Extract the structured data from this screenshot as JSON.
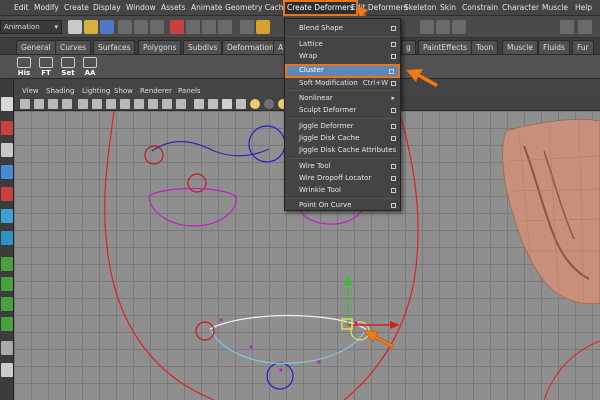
{
  "menubar": {
    "items": [
      "Edit",
      "Modify",
      "Create",
      "Display",
      "Window",
      "Assets",
      "Animate",
      "Geometry Cache",
      "Create Deformers",
      "Edit Deformers",
      "Skeleton",
      "Skin",
      "Constrain",
      "Character",
      "Muscle",
      "Help"
    ]
  },
  "statusline": {
    "mode": "Animation"
  },
  "shelf_tabs": [
    "General",
    "Curves",
    "Surfaces",
    "Polygons",
    "Subdivs",
    "Deformation",
    "A",
    "g",
    "PaintEffects",
    "Toon",
    "Muscle",
    "Fluids",
    "Fur"
  ],
  "shelf_buttons": [
    "His",
    "FT",
    "Set",
    "AA"
  ],
  "panel_menu": [
    "View",
    "Shading",
    "Lighting",
    "Show",
    "Renderer",
    "Panels"
  ],
  "dropdown": {
    "items": [
      {
        "label": "Blend Shape",
        "option": true
      },
      {
        "label": "Lattice",
        "option": true
      },
      {
        "label": "Wrap",
        "option": true
      },
      {
        "label": "Cluster",
        "option": true,
        "highlighted": true
      },
      {
        "label": "Soft Modification",
        "shortcut": "Ctrl+W",
        "option": true
      },
      {
        "label": "Nonlinear",
        "submenu": true
      },
      {
        "label": "Sculpt Deformer",
        "option": true
      },
      {
        "label": "Jiggle Deformer",
        "option": true
      },
      {
        "label": "Jiggle Disk Cache",
        "option": true
      },
      {
        "label": "Jiggle Disk Cache Attributes",
        "option": false
      },
      {
        "label": "Wire Tool",
        "option": true
      },
      {
        "label": "Wire Dropoff Locator",
        "option": true
      },
      {
        "label": "Wrinkle Tool",
        "option": true
      },
      {
        "label": "Point On Curve",
        "option": true
      }
    ]
  },
  "colors": {
    "accent": "#e8761e",
    "highlight": "#5d87b6",
    "curve_red": "#e02020",
    "curve_blue": "#2020c8",
    "curve_magenta": "#c020c0",
    "ear": "#c8907a"
  }
}
